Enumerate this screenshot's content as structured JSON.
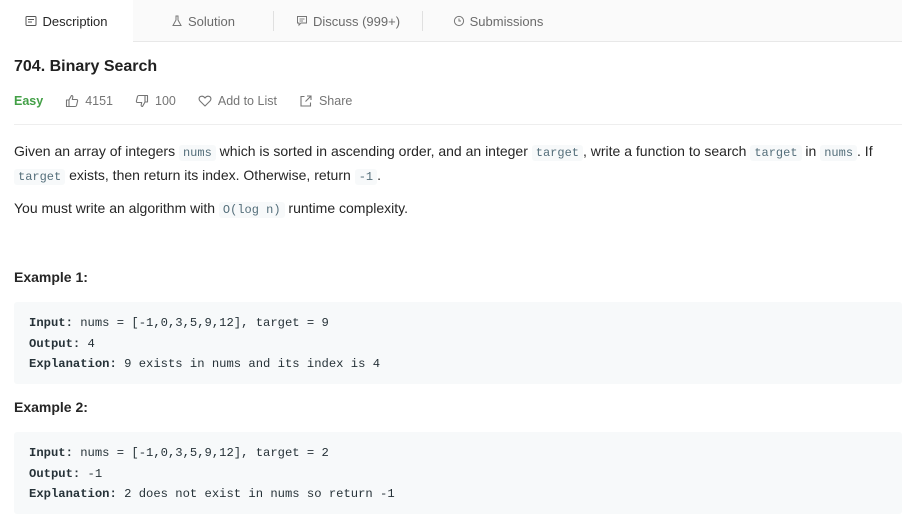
{
  "tabs": [
    {
      "label": "Description",
      "icon": "description-icon",
      "active": true
    },
    {
      "label": "Solution",
      "icon": "flask-icon",
      "active": false
    },
    {
      "label": "Discuss (999+)",
      "icon": "comment-icon",
      "active": false
    },
    {
      "label": "Submissions",
      "icon": "clock-icon",
      "active": false
    }
  ],
  "problem": {
    "title": "704. Binary Search",
    "difficulty": "Easy",
    "difficulty_color": "#43a047",
    "likes": "4151",
    "dislikes": "100",
    "add_to_list": "Add to List",
    "share": "Share"
  },
  "description": {
    "p1": {
      "t1": "Given an array of integers ",
      "c1": "nums",
      "t2": " which is sorted in ascending order, and an integer ",
      "c2": "target",
      "t3": ", write a function to search ",
      "c3": "target",
      "t4": " in ",
      "c4": "nums",
      "t5": ". If ",
      "c5": "target",
      "t6": " exists, then return its index. Otherwise, return ",
      "c6": "-1",
      "t7": "."
    },
    "p2": {
      "t1": "You must write an algorithm with ",
      "c1": "O(log n)",
      "t2": " runtime complexity."
    }
  },
  "examples": [
    {
      "heading": "Example 1:",
      "input_label": "Input:",
      "input": " nums = [-1,0,3,5,9,12], target = 9",
      "output_label": "Output:",
      "output": " 4",
      "explanation_label": "Explanation:",
      "explanation": " 9 exists in nums and its index is 4"
    },
    {
      "heading": "Example 2:",
      "input_label": "Input:",
      "input": " nums = [-1,0,3,5,9,12], target = 2",
      "output_label": "Output:",
      "output": " -1",
      "explanation_label": "Explanation:",
      "explanation": " 2 does not exist in nums so return -1"
    }
  ]
}
